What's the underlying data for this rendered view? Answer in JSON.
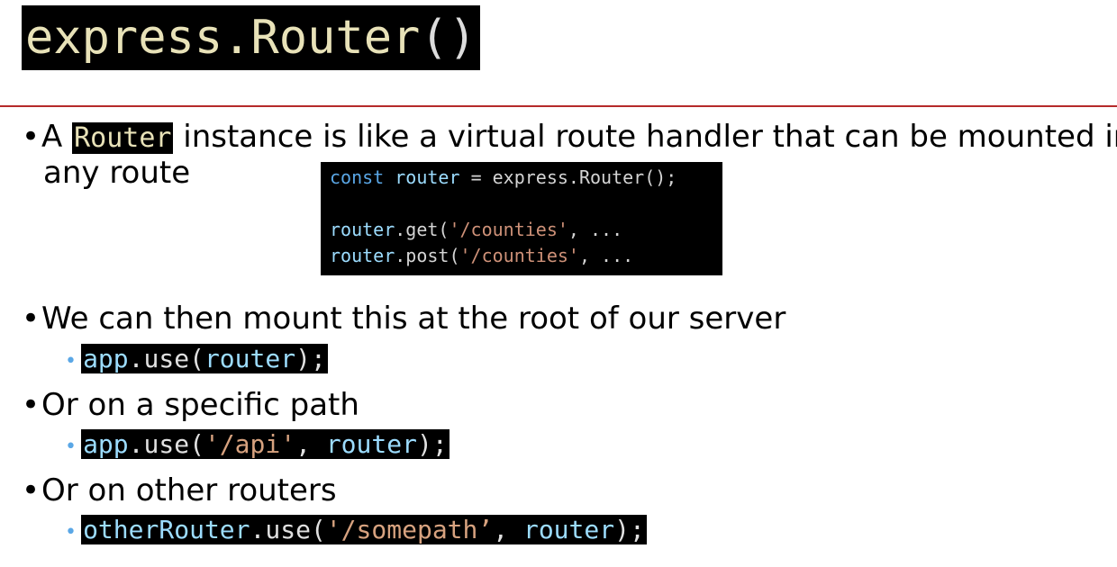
{
  "title": {
    "object": "express",
    "dot": ".",
    "method": "Router",
    "parens": "()"
  },
  "bullets": {
    "b1": {
      "prefix": "A",
      "keyword": "Router",
      "suffix": "instance is like a virtual route handler that can be mounted in",
      "line2": "any route"
    },
    "b2": {
      "text": "We can then mount this at the root of our server"
    },
    "b3": {
      "text": "Or on a specific path"
    },
    "b4": {
      "text": "Or on other routers"
    }
  },
  "code_block": {
    "line1": {
      "kw": "const",
      "var": "router",
      "rest": "= express.Router();"
    },
    "line2": {
      "var": "router",
      "rest": ".get(",
      "str": "'/counties'",
      "tail": ", ..."
    },
    "line3": {
      "var": "router",
      "rest": ".post(",
      "str": "'/counties'",
      "tail": ", ..."
    }
  },
  "examples": {
    "e1": {
      "obj": "app",
      "call": ".use(",
      "arg": "router",
      "end": ");"
    },
    "e2": {
      "obj": "app",
      "call": ".use(",
      "str": "'/api'",
      "sep": ", ",
      "arg": "router",
      "end": ");"
    },
    "e3": {
      "obj": "otherRouter",
      "call": ".use(",
      "str": "'/somepath’",
      "sep": ", ",
      "arg": "router",
      "end": ");"
    }
  },
  "bullet_symbol": "•",
  "colors": {
    "rule": "#b52a2a",
    "sub_bullet": "#5aa7e6"
  }
}
